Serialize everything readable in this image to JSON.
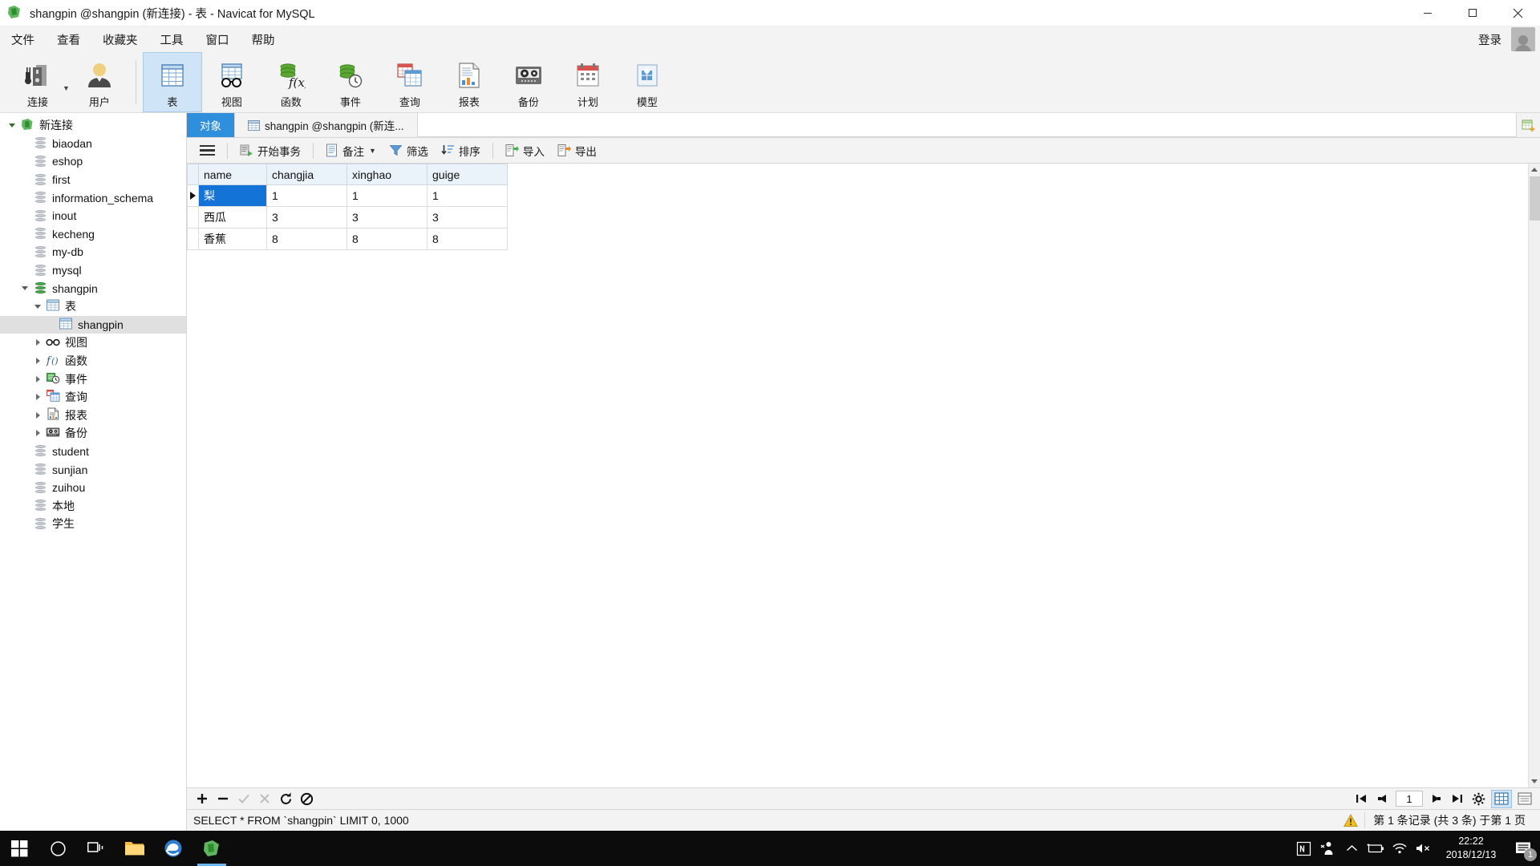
{
  "window": {
    "title": "shangpin @shangpin (新连接) - 表 - Navicat for MySQL",
    "app_icon": "navicat-logo-icon",
    "minimize": "minimize-icon",
    "maximize": "maximize-icon",
    "close": "close-icon"
  },
  "menubar": {
    "items": [
      {
        "label": "文件",
        "name": "menu-file"
      },
      {
        "label": "查看",
        "name": "menu-view"
      },
      {
        "label": "收藏夹",
        "name": "menu-favorites"
      },
      {
        "label": "工具",
        "name": "menu-tools"
      },
      {
        "label": "窗口",
        "name": "menu-window"
      },
      {
        "label": "帮助",
        "name": "menu-help"
      }
    ],
    "login_label": "登录"
  },
  "toolbar": {
    "buttons": [
      {
        "label": "连接",
        "icon": "connection-icon",
        "active": false
      },
      {
        "label": "用户",
        "icon": "user-icon",
        "active": false
      },
      {
        "label": "表",
        "icon": "table-icon",
        "active": true
      },
      {
        "label": "视图",
        "icon": "view-glasses-icon",
        "active": false
      },
      {
        "label": "函数",
        "icon": "function-icon",
        "active": false
      },
      {
        "label": "事件",
        "icon": "event-clock-icon",
        "active": false
      },
      {
        "label": "查询",
        "icon": "query-icon",
        "active": false
      },
      {
        "label": "报表",
        "icon": "report-icon",
        "active": false
      },
      {
        "label": "备份",
        "icon": "backup-icon",
        "active": false
      },
      {
        "label": "计划",
        "icon": "schedule-icon",
        "active": false
      },
      {
        "label": "模型",
        "icon": "model-icon",
        "active": false
      }
    ]
  },
  "sidebar": {
    "items": [
      {
        "label": "新连接",
        "indent": 0,
        "toggle": "down",
        "icon": "connection-green-icon",
        "selected": false
      },
      {
        "label": "biaodan",
        "indent": 1,
        "toggle": "none",
        "icon": "database-icon",
        "selected": false
      },
      {
        "label": "eshop",
        "indent": 1,
        "toggle": "none",
        "icon": "database-icon",
        "selected": false
      },
      {
        "label": "first",
        "indent": 1,
        "toggle": "none",
        "icon": "database-icon",
        "selected": false
      },
      {
        "label": "information_schema",
        "indent": 1,
        "toggle": "none",
        "icon": "database-icon",
        "selected": false
      },
      {
        "label": "inout",
        "indent": 1,
        "toggle": "none",
        "icon": "database-icon",
        "selected": false
      },
      {
        "label": "kecheng",
        "indent": 1,
        "toggle": "none",
        "icon": "database-icon",
        "selected": false
      },
      {
        "label": "my-db",
        "indent": 1,
        "toggle": "none",
        "icon": "database-icon",
        "selected": false
      },
      {
        "label": "mysql",
        "indent": 1,
        "toggle": "none",
        "icon": "database-icon",
        "selected": false
      },
      {
        "label": "shangpin",
        "indent": 1,
        "toggle": "down",
        "icon": "database-green-icon",
        "selected": false
      },
      {
        "label": "表",
        "indent": 2,
        "toggle": "down",
        "icon": "table-icon",
        "selected": false
      },
      {
        "label": "shangpin",
        "indent": 3,
        "toggle": "none",
        "icon": "table-icon",
        "selected": true
      },
      {
        "label": "视图",
        "indent": 2,
        "toggle": "right",
        "icon": "view-glasses-icon",
        "selected": false
      },
      {
        "label": "函数",
        "indent": 2,
        "toggle": "right",
        "icon": "function-icon",
        "selected": false
      },
      {
        "label": "事件",
        "indent": 2,
        "toggle": "right",
        "icon": "event-clock-icon",
        "selected": false
      },
      {
        "label": "查询",
        "indent": 2,
        "toggle": "right",
        "icon": "query-icon",
        "selected": false
      },
      {
        "label": "报表",
        "indent": 2,
        "toggle": "right",
        "icon": "report-icon",
        "selected": false
      },
      {
        "label": "备份",
        "indent": 2,
        "toggle": "right",
        "icon": "backup-icon",
        "selected": false
      },
      {
        "label": "student",
        "indent": 1,
        "toggle": "none",
        "icon": "database-icon",
        "selected": false
      },
      {
        "label": "sunjian",
        "indent": 1,
        "toggle": "none",
        "icon": "database-icon",
        "selected": false
      },
      {
        "label": "zuihou",
        "indent": 1,
        "toggle": "none",
        "icon": "database-icon",
        "selected": false
      },
      {
        "label": "本地",
        "indent": 1,
        "toggle": "none",
        "icon": "database-icon",
        "selected": false
      },
      {
        "label": "学生",
        "indent": 1,
        "toggle": "none",
        "icon": "database-icon",
        "selected": false
      }
    ]
  },
  "tabs": [
    {
      "label": "对象",
      "icon": "none",
      "active": true
    },
    {
      "label": "shangpin @shangpin (新连...",
      "icon": "table-icon",
      "active": false
    }
  ],
  "grid_toolbar": {
    "menu_icon": "hamburger-icon",
    "buttons": [
      {
        "label": "开始事务",
        "icon": "transaction-icon",
        "dropdown": false
      },
      {
        "label": "备注",
        "icon": "note-icon",
        "dropdown": true
      },
      {
        "label": "筛选",
        "icon": "filter-icon",
        "dropdown": false
      },
      {
        "label": "排序",
        "icon": "sort-icon",
        "dropdown": false
      },
      {
        "label": "导入",
        "icon": "import-icon",
        "dropdown": false
      },
      {
        "label": "导出",
        "icon": "export-icon",
        "dropdown": false
      }
    ]
  },
  "datagrid": {
    "columns": [
      "name",
      "changjia",
      "xinghao",
      "guige"
    ],
    "rows": [
      {
        "cells": [
          "梨",
          "1",
          "1",
          "1"
        ],
        "selected": true,
        "current": true
      },
      {
        "cells": [
          "西瓜",
          "3",
          "3",
          "3"
        ],
        "selected": false,
        "current": false
      },
      {
        "cells": [
          "香蕉",
          "8",
          "8",
          "8"
        ],
        "selected": false,
        "current": false
      }
    ]
  },
  "grid_footer": {
    "buttons": [
      {
        "name": "add-record-button",
        "icon": "plus-icon",
        "enabled": true
      },
      {
        "name": "delete-record-button",
        "icon": "minus-icon",
        "enabled": true
      },
      {
        "name": "apply-change-button",
        "icon": "check-icon",
        "enabled": false
      },
      {
        "name": "cancel-change-button",
        "icon": "cross-icon",
        "enabled": false
      },
      {
        "name": "refresh-button",
        "icon": "refresh-icon",
        "enabled": true
      },
      {
        "name": "stop-button",
        "icon": "stop-icon",
        "enabled": true
      }
    ],
    "nav": {
      "first": "first-page-icon",
      "prev": "prev-page-icon",
      "page_value": "1",
      "next": "next-page-icon",
      "last": "last-page-icon",
      "settings": "gear-icon"
    },
    "view_modes": [
      {
        "name": "grid-view-toggle",
        "icon": "grid-view-icon",
        "active": true
      },
      {
        "name": "form-view-toggle",
        "icon": "form-view-icon",
        "active": false
      }
    ]
  },
  "statusbar": {
    "sql": "SELECT * FROM `shangpin` LIMIT 0, 1000",
    "warning_icon": "warning-icon",
    "record_info": "第 1 条记录 (共 3 条) 于第 1 页"
  },
  "taskbar": {
    "start": "windows-start-icon",
    "search": "search-circle-icon",
    "taskview": "task-view-icon",
    "apps": [
      {
        "name": "file-explorer-icon",
        "active": false
      },
      {
        "name": "edge-browser-icon",
        "active": false
      },
      {
        "name": "navicat-icon",
        "active": true
      }
    ],
    "tray": [
      {
        "name": "onenote-tray-icon",
        "glyph": "M"
      },
      {
        "name": "people-tray-icon",
        "glyph": "people"
      },
      {
        "name": "show-hidden-icons",
        "glyph": "chevron-up"
      },
      {
        "name": "battery-tray-icon",
        "glyph": "battery"
      },
      {
        "name": "network-tray-icon",
        "glyph": "wifi"
      },
      {
        "name": "volume-tray-icon",
        "glyph": "volume-mute"
      }
    ],
    "clock": {
      "time": "22:22",
      "date": "2018/12/13"
    },
    "notification": {
      "icon": "notification-icon",
      "count": "1"
    }
  },
  "colors": {
    "accent_blue": "#2f8fdc",
    "selection_blue": "#1473d6",
    "toolbar_bg": "#f3f3f3",
    "header_blue": "#eaf2fa",
    "green": "#4caf50"
  }
}
